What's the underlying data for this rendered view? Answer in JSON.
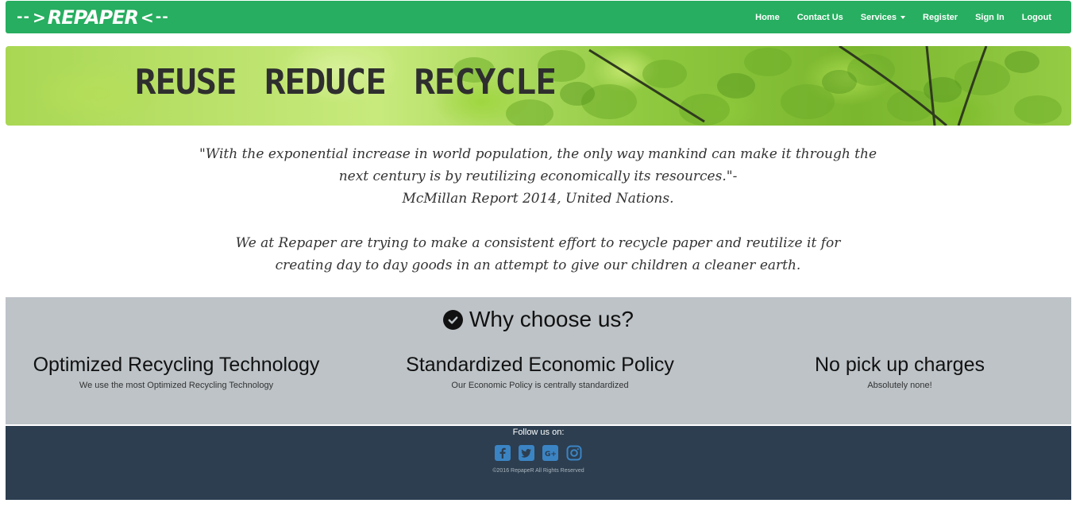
{
  "brand": {
    "name": "REPAPER",
    "dashes": "--",
    "chev_left": ">",
    "chev_right": "<"
  },
  "nav": {
    "home": "Home",
    "contact": "Contact Us",
    "services": "Services",
    "register": "Register",
    "signin": "Sign In",
    "logout": "Logout"
  },
  "hero": {
    "title": "REUSE REDUCE RECYCLE"
  },
  "intro": {
    "quote_line1": "\"With the exponential increase in world population, the only way mankind can make it through the",
    "quote_line2": "next century is by reutilizing economically its resources.\"-",
    "attribution": "McMillan Report 2014, United Nations.",
    "mission_line1": "We at Repaper are trying to make a consistent effort to recycle paper and reutilize it for",
    "mission_line2": "creating day to day goods in an attempt to give our children a cleaner earth."
  },
  "why": {
    "heading": "Why choose us?",
    "features": [
      {
        "title": "Optimized Recycling Technology",
        "desc": "We use the most Optimized Recycling Technology"
      },
      {
        "title": "Standardized Economic Policy",
        "desc": "Our Economic Policy is centrally standardized"
      },
      {
        "title": "No pick up charges",
        "desc": "Absolutely none!"
      }
    ]
  },
  "footer": {
    "follow": "Follow us on:",
    "copyright": "©2016 RepapeR All Rights Reserved"
  },
  "colors": {
    "nav_bg": "#27ae60",
    "why_bg": "#bdc3c7",
    "footer_bg": "#2c3e50",
    "social_icon": "#3b84c4"
  },
  "icons": [
    "check-circle-icon",
    "facebook-icon",
    "twitter-icon",
    "google-plus-icon",
    "instagram-icon"
  ]
}
